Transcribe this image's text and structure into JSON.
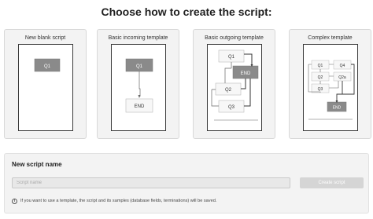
{
  "page": {
    "title": "Choose how to create the script:"
  },
  "templates": [
    {
      "label": "New blank script"
    },
    {
      "label": "Basic incoming template"
    },
    {
      "label": "Basic outgoing template"
    },
    {
      "label": "Complex template"
    }
  ],
  "diagram_labels": {
    "blank": {
      "q1": "Q1"
    },
    "incoming": {
      "q1": "Q1",
      "end": "END"
    },
    "outgoing": {
      "q1": "Q1",
      "end": "END",
      "q2": "Q2",
      "q3": "Q3"
    },
    "complex": {
      "q1": "Q1",
      "q4": "Q4",
      "q2": "Q2",
      "q2a": "Q2a",
      "q3": "Q3",
      "end": "END"
    }
  },
  "new_script": {
    "heading": "New script name",
    "input_placeholder": "Script name",
    "input_value": "",
    "create_label": "Create script",
    "info_icon": "info-icon",
    "info_text": "If you want to use a template, the script and its samples (database fields, terminations) will be saved."
  },
  "colors": {
    "node_dark": "#8a8a8a",
    "node_light": "#f7f7f7",
    "button_disabled": "#d5d5d5"
  }
}
